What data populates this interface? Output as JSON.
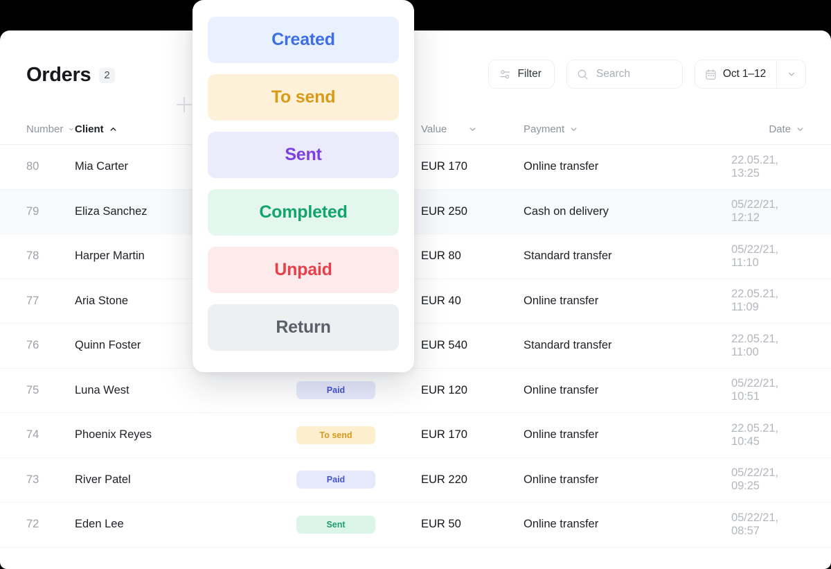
{
  "header": {
    "title": "Orders",
    "count": "2",
    "add_icon": "plus-icon"
  },
  "toolbar": {
    "filter_label": "Filter",
    "filter_icon": "sliders-icon",
    "search_placeholder": "Search",
    "search_icon": "search-icon",
    "date_label": "Oct 1–12",
    "calendar_icon": "calendar-icon",
    "caret_icon": "chevron-down-icon"
  },
  "table": {
    "columns": [
      {
        "label": "Number",
        "sorted": false,
        "caret": "chevron-down-icon"
      },
      {
        "label": "Client",
        "sorted": true,
        "caret": "chevron-up-icon"
      },
      {
        "label": "",
        "sorted": false,
        "caret": ""
      },
      {
        "label": "Value",
        "sorted": false,
        "caret": "chevron-down-icon"
      },
      {
        "label": "Payment",
        "sorted": false,
        "caret": "chevron-down-icon"
      },
      {
        "label": "Date",
        "sorted": false,
        "caret": "chevron-down-icon"
      }
    ],
    "rows": [
      {
        "number": "80",
        "client": "Mia Carter",
        "status": "",
        "value": "EUR 170",
        "payment": "Online transfer",
        "date": "22.05.21, 13:25",
        "highlight": false
      },
      {
        "number": "79",
        "client": "Eliza Sanchez",
        "status": "",
        "value": "EUR 250",
        "payment": "Cash on delivery",
        "date": "05/22/21, 12:12",
        "highlight": true
      },
      {
        "number": "78",
        "client": "Harper Martin",
        "status": "",
        "value": "EUR 80",
        "payment": "Standard transfer",
        "date": "05/22/21, 11:10",
        "highlight": false
      },
      {
        "number": "77",
        "client": "Aria Stone",
        "status": "",
        "value": "EUR 40",
        "payment": "Online transfer",
        "date": "22.05.21, 11:09",
        "highlight": false
      },
      {
        "number": "76",
        "client": "Quinn Foster",
        "status": "",
        "value": "EUR 540",
        "payment": "Standard transfer",
        "date": "22.05.21, 11:00",
        "highlight": false
      },
      {
        "number": "75",
        "client": "Luna West",
        "status": "Paid",
        "value": "EUR 120",
        "payment": "Online transfer",
        "date": "05/22/21, 10:51",
        "highlight": false
      },
      {
        "number": "74",
        "client": "Phoenix Reyes",
        "status": "To send",
        "value": "EUR 170",
        "payment": "Online transfer",
        "date": "22.05.21, 10:45",
        "highlight": false
      },
      {
        "number": "73",
        "client": "River Patel",
        "status": "Paid",
        "value": "EUR 220",
        "payment": "Online transfer",
        "date": "05/22/21, 09:25",
        "highlight": false
      },
      {
        "number": "72",
        "client": "Eden Lee",
        "status": "Sent",
        "value": "EUR 50",
        "payment": "Online transfer",
        "date": "05/22/21, 08:57",
        "highlight": false
      }
    ],
    "badge_styles": {
      "Paid": {
        "bg": "#e6e9fb",
        "fg": "#4352d4"
      },
      "To send": {
        "bg": "#fdeecd",
        "fg": "#d79a20"
      },
      "Sent": {
        "bg": "#dcf5ea",
        "fg": "#1e9c6b"
      }
    }
  },
  "status_menu": {
    "options": [
      {
        "label": "Created",
        "bg": "#e8f1fd",
        "fg": "#3d6ee8"
      },
      {
        "label": "To send",
        "bg": "#fdf2d9",
        "fg": "#d99a17"
      },
      {
        "label": "Sent",
        "bg": "#ecebfb",
        "fg": "#7b3fe4"
      },
      {
        "label": "Completed",
        "bg": "#e4f7ee",
        "fg": "#11a46b"
      },
      {
        "label": "Unpaid",
        "bg": "#fdeaea",
        "fg": "#e8404a"
      },
      {
        "label": "Return",
        "bg": "#eeeff1",
        "fg": "#5a6069"
      }
    ]
  }
}
